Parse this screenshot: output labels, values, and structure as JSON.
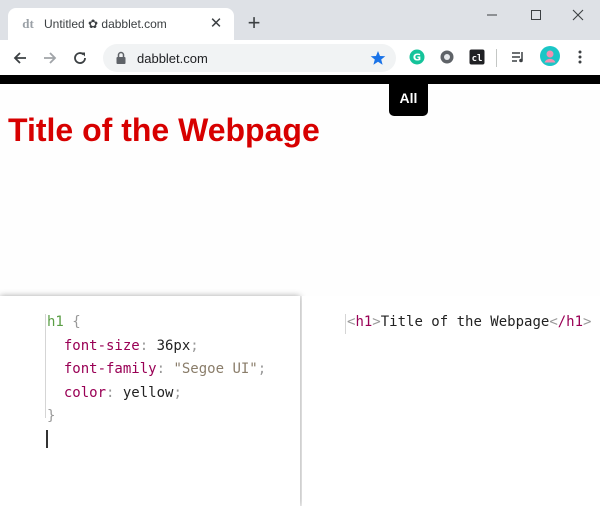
{
  "browser": {
    "tab": {
      "title": "Untitled ✿ dabblet.com",
      "favicon": "dabblet-icon",
      "close": "✕"
    },
    "new_tab": "+",
    "window_controls": [
      "minimize-icon",
      "maximize-icon",
      "close-icon"
    ],
    "url": "dabblet.com",
    "extensions": [
      "grammarly-icon",
      "extension-circle-icon",
      "cl-extension-icon",
      "media-queue-icon",
      "profile-avatar"
    ],
    "extension_cl_label": "cl",
    "accent": "#1a73e8"
  },
  "preview": {
    "heading": "Title of the Webpage",
    "heading_color": "#d70000",
    "all_button": "All"
  },
  "css_editor": {
    "selector": "h1",
    "open_brace": "{",
    "close_brace": "}",
    "rules": [
      {
        "property": "font-size",
        "value": "36px"
      },
      {
        "property": "font-family",
        "value": "\"Segoe UI\""
      },
      {
        "property": "color",
        "value": "yellow"
      }
    ]
  },
  "html_editor": {
    "open_tag": "h1",
    "text": "Title of the Webpage",
    "close_tag": "/h1"
  }
}
